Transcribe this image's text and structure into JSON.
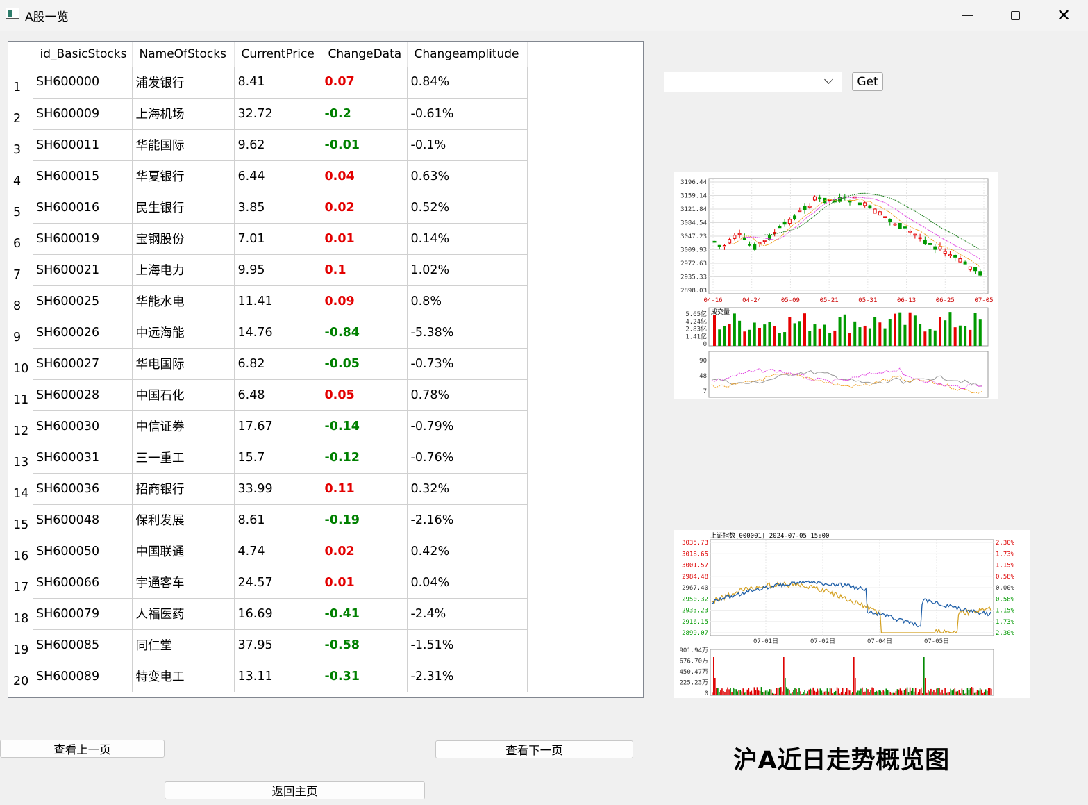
{
  "window": {
    "title": "A股一览",
    "close_glyph": "✕"
  },
  "table": {
    "headers": [
      "id_BasicStocks",
      "NameOfStocks",
      "CurrentPrice",
      "ChangeData",
      "Changeamplitude"
    ],
    "rows": [
      {
        "n": "1",
        "id": "SH600000",
        "name": "浦发银行",
        "price": "8.41",
        "change": "0.07",
        "amp": "0.84%"
      },
      {
        "n": "2",
        "id": "SH600009",
        "name": "上海机场",
        "price": "32.72",
        "change": "-0.2",
        "amp": "-0.61%"
      },
      {
        "n": "3",
        "id": "SH600011",
        "name": "华能国际",
        "price": "9.62",
        "change": "-0.01",
        "amp": "-0.1%"
      },
      {
        "n": "4",
        "id": "SH600015",
        "name": "华夏银行",
        "price": "6.44",
        "change": "0.04",
        "amp": "0.63%"
      },
      {
        "n": "5",
        "id": "SH600016",
        "name": "民生银行",
        "price": "3.85",
        "change": "0.02",
        "amp": "0.52%"
      },
      {
        "n": "6",
        "id": "SH600019",
        "name": "宝钢股份",
        "price": "7.01",
        "change": "0.01",
        "amp": "0.14%"
      },
      {
        "n": "7",
        "id": "SH600021",
        "name": "上海电力",
        "price": "9.95",
        "change": "0.1",
        "amp": "1.02%"
      },
      {
        "n": "8",
        "id": "SH600025",
        "name": "华能水电",
        "price": "11.41",
        "change": "0.09",
        "amp": "0.8%"
      },
      {
        "n": "9",
        "id": "SH600026",
        "name": "中远海能",
        "price": "14.76",
        "change": "-0.84",
        "amp": "-5.38%"
      },
      {
        "n": "10",
        "id": "SH600027",
        "name": "华电国际",
        "price": "6.82",
        "change": "-0.05",
        "amp": "-0.73%"
      },
      {
        "n": "11",
        "id": "SH600028",
        "name": "中国石化",
        "price": "6.48",
        "change": "0.05",
        "amp": "0.78%"
      },
      {
        "n": "12",
        "id": "SH600030",
        "name": "中信证券",
        "price": "17.67",
        "change": "-0.14",
        "amp": "-0.79%"
      },
      {
        "n": "13",
        "id": "SH600031",
        "name": "三一重工",
        "price": "15.7",
        "change": "-0.12",
        "amp": "-0.76%"
      },
      {
        "n": "14",
        "id": "SH600036",
        "name": "招商银行",
        "price": "33.99",
        "change": "0.11",
        "amp": "0.32%"
      },
      {
        "n": "15",
        "id": "SH600048",
        "name": "保利发展",
        "price": "8.61",
        "change": "-0.19",
        "amp": "-2.16%"
      },
      {
        "n": "16",
        "id": "SH600050",
        "name": "中国联通",
        "price": "4.74",
        "change": "0.02",
        "amp": "0.42%"
      },
      {
        "n": "17",
        "id": "SH600066",
        "name": "宇通客车",
        "price": "24.57",
        "change": "0.01",
        "amp": "0.04%"
      },
      {
        "n": "18",
        "id": "SH600079",
        "name": "人福医药",
        "price": "16.69",
        "change": "-0.41",
        "amp": "-2.4%"
      },
      {
        "n": "19",
        "id": "SH600085",
        "name": "同仁堂",
        "price": "37.95",
        "change": "-0.58",
        "amp": "-1.51%"
      },
      {
        "n": "20",
        "id": "SH600089",
        "name": "特变电工",
        "price": "13.11",
        "change": "-0.31",
        "amp": "-2.31%"
      }
    ]
  },
  "controls": {
    "combo_value": "",
    "get_label": "Get"
  },
  "kline_chart": {
    "price_ticks": [
      "3196.44",
      "3159.14",
      "3121.84",
      "3084.54",
      "3047.23",
      "3009.93",
      "2972.63",
      "2935.33",
      "2898.03"
    ],
    "date_ticks": [
      "04-16",
      "04-24",
      "05-09",
      "05-21",
      "05-31",
      "06-13",
      "06-25",
      "07-05"
    ],
    "volume_label": "成交量",
    "volume_ticks": [
      "5.65亿",
      "4.24亿",
      "2.83亿",
      "1.41亿",
      "0"
    ],
    "osc_ticks": [
      "90",
      "48",
      "7"
    ],
    "up_color": "#e60000",
    "down_color": "#009900"
  },
  "intraday_chart": {
    "title": "上证指数[000001] 2024-07-05 15:00",
    "price_ticks": [
      "3035.73",
      "3018.65",
      "3001.57",
      "2984.48",
      "2967.40",
      "2950.32",
      "2933.23",
      "2916.15",
      "2899.07"
    ],
    "pct_ticks": [
      "2.30%",
      "1.73%",
      "1.15%",
      "0.58%",
      "0.00%",
      "0.58%",
      "1.15%",
      "1.73%",
      "2.30%"
    ],
    "time_ticks": [
      "07-01日",
      "07-02日",
      "07-04日",
      "07-05日"
    ],
    "volume_ticks": [
      "901.94万",
      "676.70万",
      "450.47万",
      "225.23万",
      "0"
    ],
    "index_color": "#1f5fa8",
    "avg_color": "#d4a020"
  },
  "buttons": {
    "prev": "查看上一页",
    "next": "查看下一页",
    "home": "返回主页"
  },
  "caption": "沪A近日走势概览图"
}
